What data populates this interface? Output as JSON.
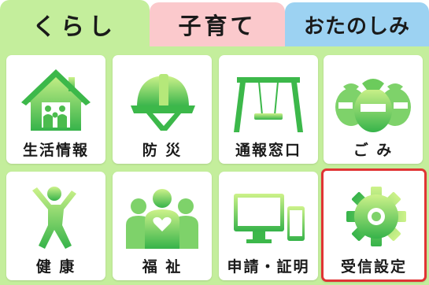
{
  "tabs": [
    {
      "label": "くらし",
      "color": "#c4ee9c",
      "active": true
    },
    {
      "label": "子育て",
      "color": "#fbc9cc",
      "active": false
    },
    {
      "label": "おたのしみ",
      "color": "#9cd2f2",
      "active": false
    }
  ],
  "tiles": [
    {
      "label": "生活情報",
      "icon": "house-icon"
    },
    {
      "label": "防 災",
      "icon": "helmet-icon"
    },
    {
      "label": "通報窓口",
      "icon": "swing-icon"
    },
    {
      "label": "ご み",
      "icon": "garbage-bags-icon"
    },
    {
      "label": "健 康",
      "icon": "exercise-person-icon"
    },
    {
      "label": "福 祉",
      "icon": "people-heart-icon"
    },
    {
      "label": "申請・証明",
      "icon": "devices-icon"
    },
    {
      "label": "受信設定",
      "icon": "gear-icon",
      "selected": true,
      "highlight_color": "#e03434"
    }
  ],
  "colors": {
    "icon_green_light": "#c8f08a",
    "icon_green_dark": "#3cb84a"
  }
}
